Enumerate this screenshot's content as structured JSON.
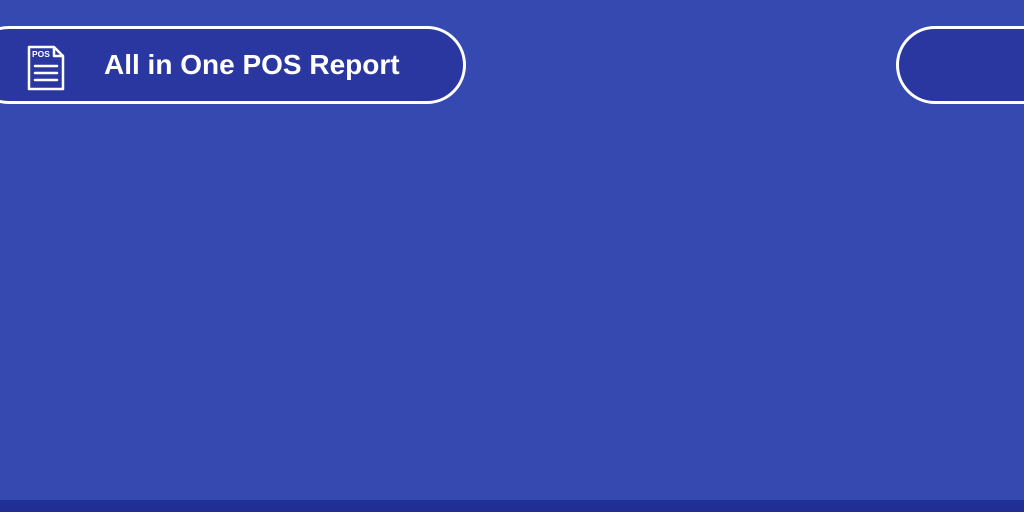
{
  "header": {
    "title": "All in One POS Report",
    "icon": "pos-document-icon",
    "icon_text": "POS"
  },
  "colors": {
    "background": "#3549b0",
    "banner": "#2a37a0",
    "border": "#ffffff",
    "bottom_bar": "#212f94"
  }
}
